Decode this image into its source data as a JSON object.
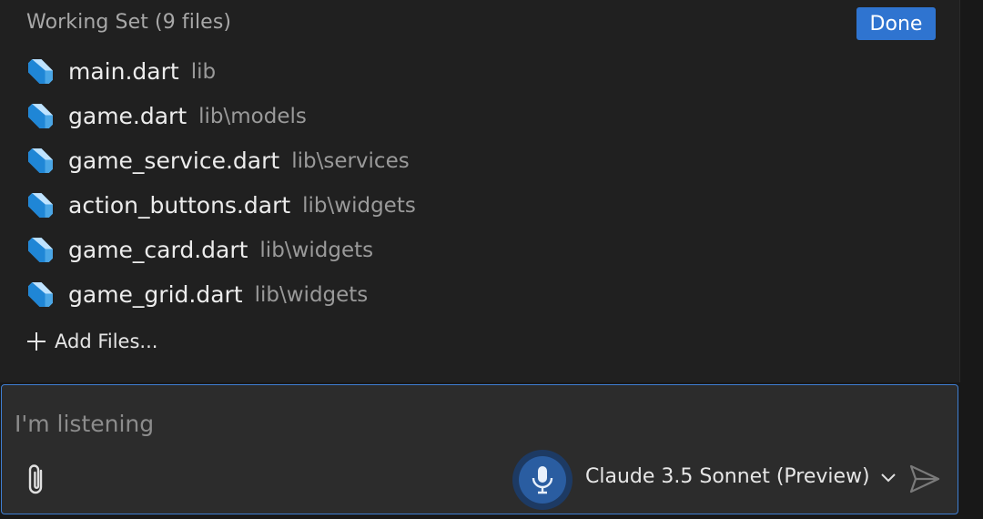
{
  "working_set": {
    "title": "Working Set (9 files)",
    "done_label": "Done",
    "files": [
      {
        "name": "main.dart",
        "path": "lib",
        "icon": "dart-file-icon"
      },
      {
        "name": "game.dart",
        "path": "lib\\models",
        "icon": "dart-file-icon"
      },
      {
        "name": "game_service.dart",
        "path": "lib\\services",
        "icon": "dart-file-icon"
      },
      {
        "name": "action_buttons.dart",
        "path": "lib\\widgets",
        "icon": "dart-file-icon"
      },
      {
        "name": "game_card.dart",
        "path": "lib\\widgets",
        "icon": "dart-file-icon"
      },
      {
        "name": "game_grid.dart",
        "path": "lib\\widgets",
        "icon": "dart-file-icon"
      }
    ],
    "add_files_label": "Add Files..."
  },
  "chat_input": {
    "placeholder": "I'm listening",
    "model_label": "Claude 3.5 Sonnet (Preview)",
    "icons": [
      "paperclip-icon",
      "microphone-icon",
      "chevron-down-icon",
      "send-icon"
    ]
  },
  "colors": {
    "accent": "#2f74d0",
    "panel_bg": "#202020",
    "input_bg": "#2c2c2c",
    "input_border": "#3f7fd3",
    "mic_active": "#2a5da1"
  }
}
